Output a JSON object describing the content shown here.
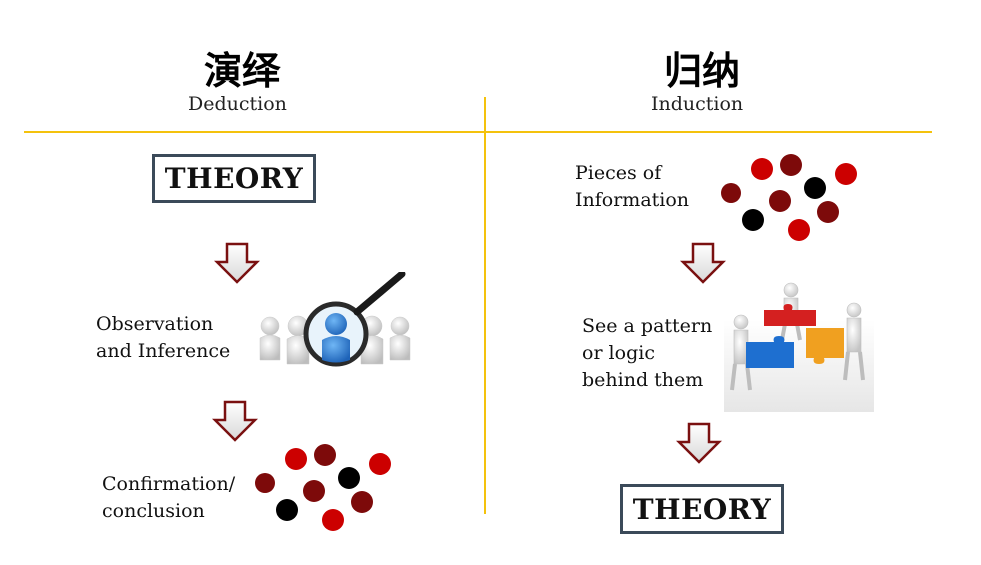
{
  "left": {
    "title_cn": "演绎",
    "title_en": "Deduction",
    "theory_label": "THEORY",
    "step1_line1": "Observation",
    "step1_line2": "and Inference",
    "step2_line1": "Confirmation/",
    "step2_line2": "conclusion"
  },
  "right": {
    "title_cn": "归纳",
    "title_en": "Induction",
    "step1_line1": "Pieces of",
    "step1_line2": "Information",
    "step2_line1": "See a pattern",
    "step2_line2": "or logic",
    "step2_line3": "behind them",
    "theory_label": "THEORY"
  },
  "colors": {
    "divider": "#f4c20d",
    "box_border": "#3b4a59",
    "arrow_stroke": "#7a1010",
    "dot_red": "#cc0000",
    "dot_dark_red": "#7d0a0a",
    "dot_black": "#000000",
    "puzzle_red": "#d42020",
    "puzzle_blue": "#1e6fd0",
    "puzzle_orange": "#f0a020"
  },
  "icons": [
    "down-arrow-icon",
    "magnifier-people-icon",
    "puzzle-people-icon",
    "dot-cluster-icon"
  ]
}
